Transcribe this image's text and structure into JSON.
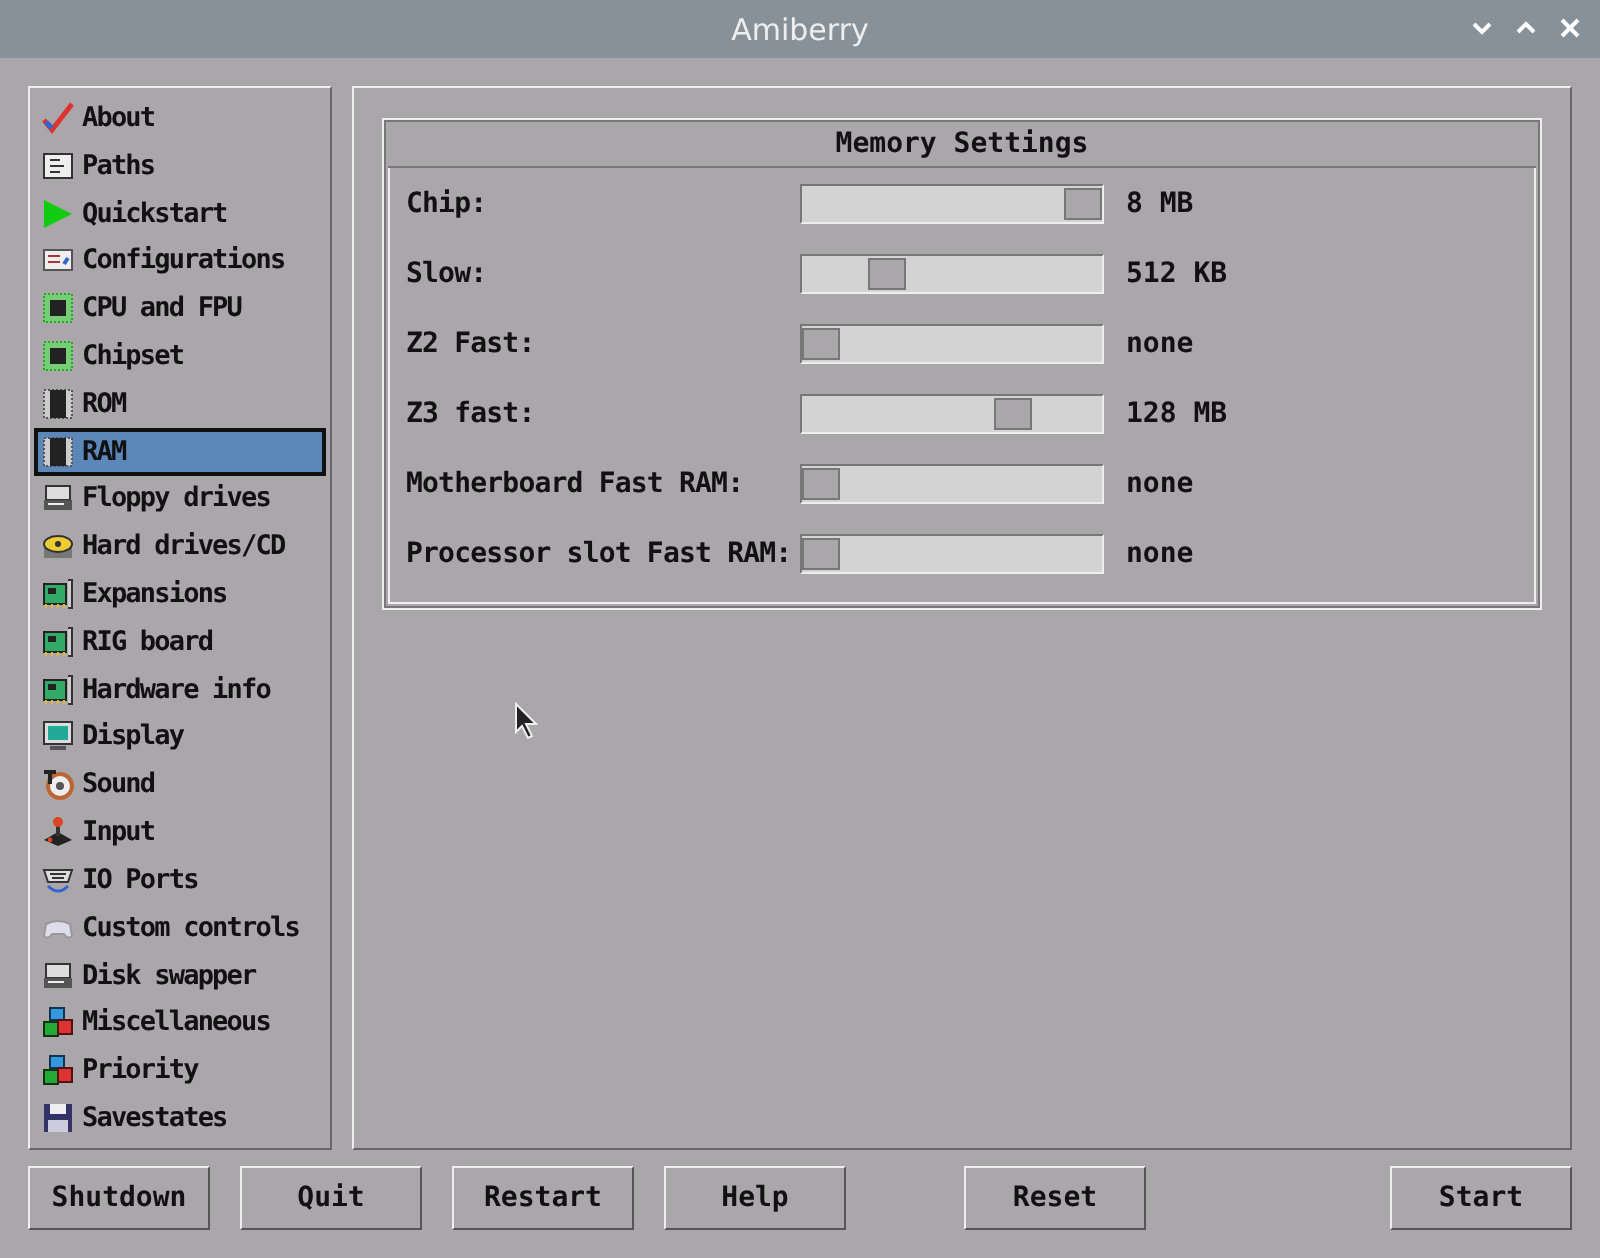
{
  "window": {
    "title": "Amiberry"
  },
  "sidebar": {
    "items": [
      {
        "label": "About",
        "kind": "check",
        "selected": false
      },
      {
        "label": "Paths",
        "kind": "document",
        "selected": false
      },
      {
        "label": "Quickstart",
        "kind": "play",
        "selected": false
      },
      {
        "label": "Configurations",
        "kind": "form",
        "selected": false
      },
      {
        "label": "CPU and FPU",
        "kind": "chip",
        "selected": false
      },
      {
        "label": "Chipset",
        "kind": "chip",
        "selected": false
      },
      {
        "label": "ROM",
        "kind": "memory",
        "selected": false
      },
      {
        "label": "RAM",
        "kind": "memory",
        "selected": true
      },
      {
        "label": "Floppy drives",
        "kind": "drive",
        "selected": false
      },
      {
        "label": "Hard drives/CD",
        "kind": "disc",
        "selected": false
      },
      {
        "label": "Expansions",
        "kind": "card",
        "selected": false
      },
      {
        "label": "RIG board",
        "kind": "card",
        "selected": false
      },
      {
        "label": "Hardware info",
        "kind": "card",
        "selected": false
      },
      {
        "label": "Display",
        "kind": "monitor",
        "selected": false
      },
      {
        "label": "Sound",
        "kind": "speaker",
        "selected": false
      },
      {
        "label": "Input",
        "kind": "joystick",
        "selected": false
      },
      {
        "label": "IO Ports",
        "kind": "port",
        "selected": false
      },
      {
        "label": "Custom controls",
        "kind": "gamepad",
        "selected": false
      },
      {
        "label": "Disk swapper",
        "kind": "drive",
        "selected": false
      },
      {
        "label": "Miscellaneous",
        "kind": "cubes",
        "selected": false
      },
      {
        "label": "Priority",
        "kind": "cubes",
        "selected": false
      },
      {
        "label": "Savestates",
        "kind": "floppy",
        "selected": false
      }
    ]
  },
  "memory_settings": {
    "title": "Memory Settings",
    "rows": [
      {
        "label": "Chip:",
        "level": 1,
        "reading": "8 MB"
      },
      {
        "label": "Slow:",
        "level": 0.25,
        "reading": "512 KB"
      },
      {
        "label": "Z2 Fast:",
        "level": 0,
        "reading": "none"
      },
      {
        "label": "Z3 fast:",
        "level": 0.73,
        "reading": "128 MB"
      },
      {
        "label": "Motherboard Fast RAM:",
        "level": 0,
        "reading": "none"
      },
      {
        "label": "Processor slot Fast RAM:",
        "level": 0,
        "reading": "none"
      }
    ]
  },
  "buttons_left": [
    "Shutdown",
    "Quit",
    "Restart",
    "Help"
  ],
  "buttons_right": [
    "Reset",
    "Start"
  ]
}
